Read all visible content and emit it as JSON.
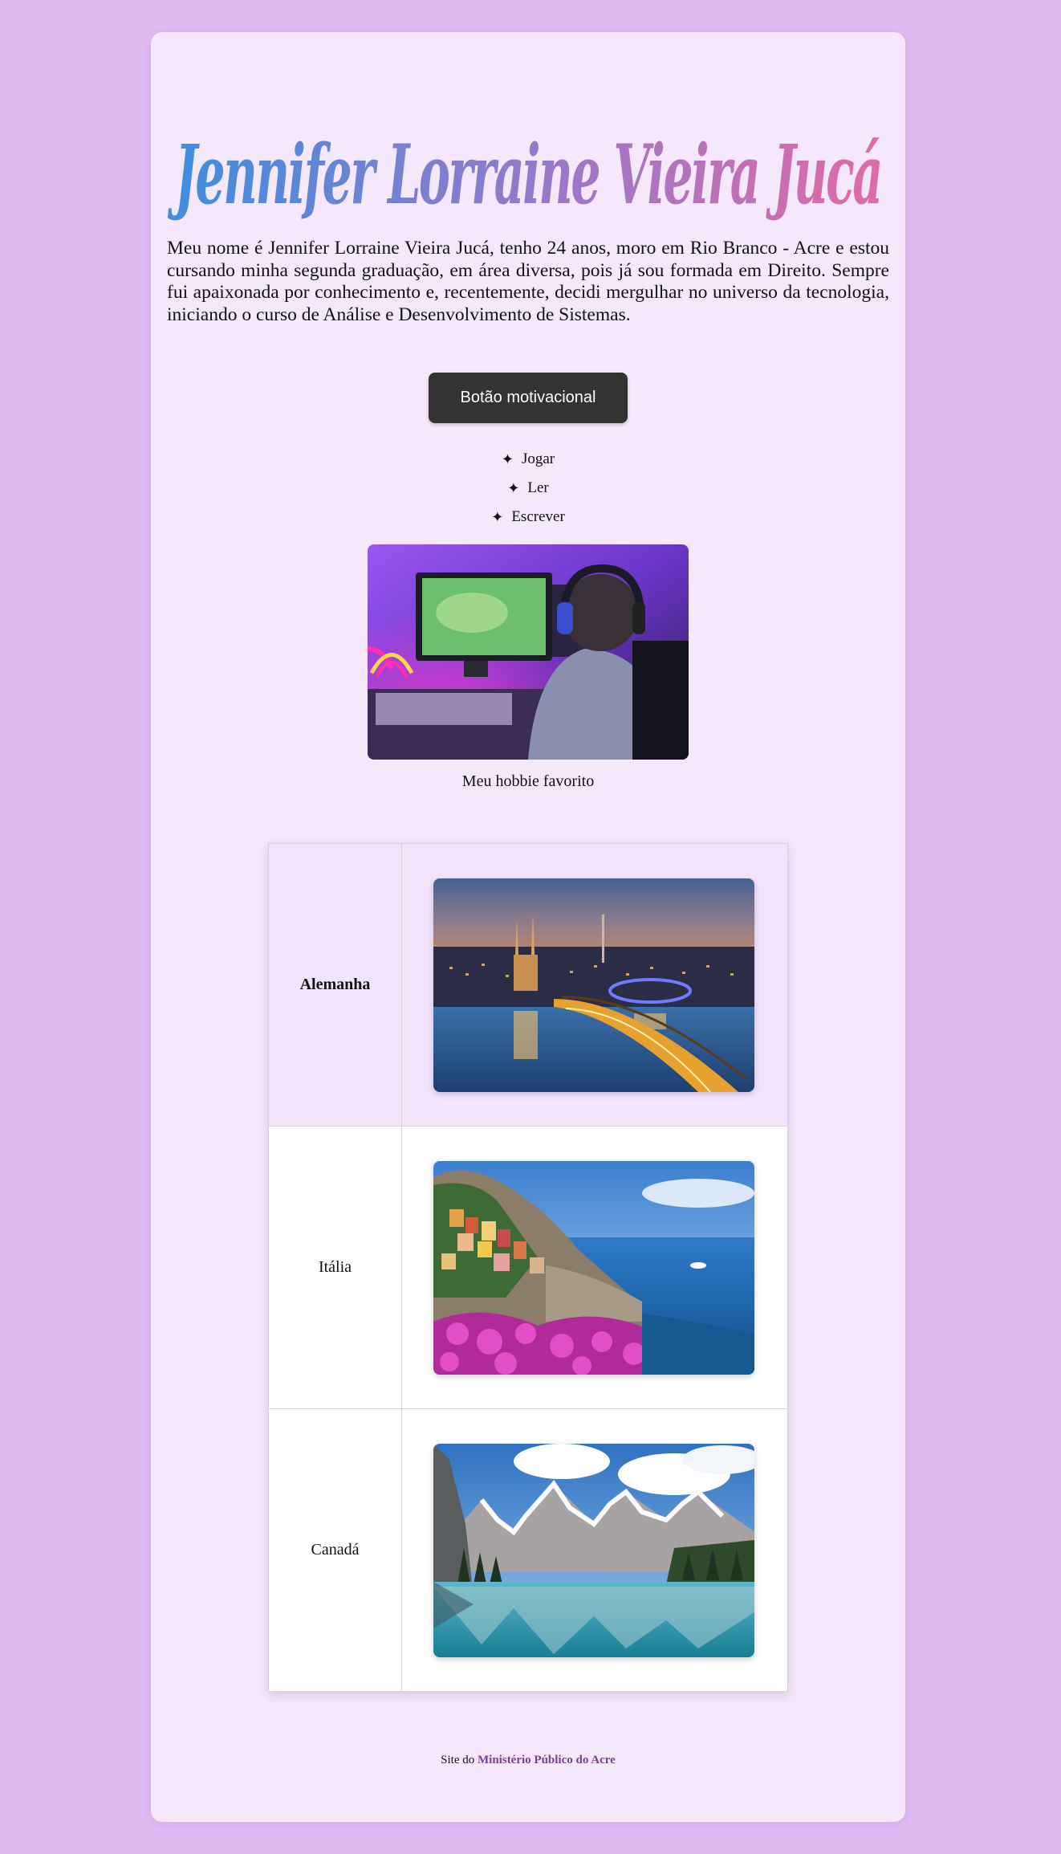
{
  "header": {
    "title": "Jennifer Lorraine Vieira Jucá"
  },
  "intro": {
    "text": "Meu nome é Jennifer Lorraine Vieira Jucá, tenho 24 anos, moro em Rio Branco - Acre e estou cursando minha segunda graduação, em área diversa, pois já sou formada em Direito. Sempre fui apaixonada por conhecimento e, recentemente, decidi mergulhar no universo da tecnologia, iniciando o curso de Análise e Desenvolvimento de Sistemas."
  },
  "motivational_button": {
    "label": "Botão motivacional"
  },
  "hobbies": {
    "bullet": "✦",
    "items": [
      "Jogar",
      "Ler",
      "Escrever"
    ],
    "image_icon": "gamer-photo",
    "caption": "Meu hobbie favorito"
  },
  "countries": [
    {
      "name": "Alemanha",
      "image_icon": "cologne-cathedral-night-photo"
    },
    {
      "name": "Itália",
      "image_icon": "cinque-terre-coast-photo"
    },
    {
      "name": "Canadá",
      "image_icon": "mountain-lake-photo"
    }
  ],
  "footer": {
    "prefix": "Site do",
    "link_text": "Ministério Público do Acre"
  },
  "colors": {
    "page_background": "#dfbaf3",
    "card_background": "#f5e8fb",
    "title_gradient_start": "#3f8ede",
    "title_gradient_end": "#e06aa8",
    "button_background": "#333333",
    "highlight_row": "#f2e4fc",
    "footer_link": "#7a3f95"
  }
}
